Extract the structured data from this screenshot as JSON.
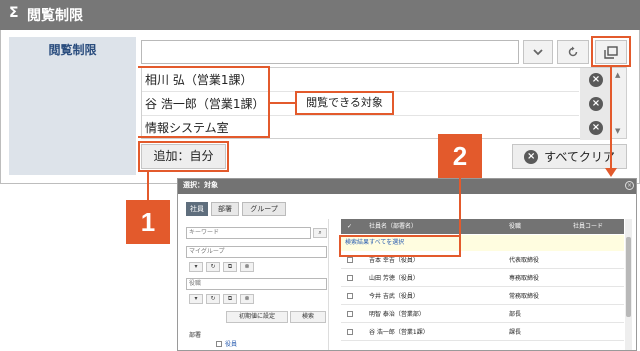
{
  "section": {
    "icon": "sigma-icon",
    "title": "閲覧制限"
  },
  "field": {
    "label": "閲覧制限",
    "selected": [
      "相川 弘（営業1課）",
      "谷 浩一郎（営業1課）",
      "情報システム室"
    ],
    "add_button": "追加：自分",
    "clear_button": "すべてクリア"
  },
  "callouts": {
    "list_label": "閲覧できる対象",
    "number_1": "1",
    "number_2": "2"
  },
  "dialog": {
    "title": "選択：対象",
    "tabs": [
      "社員",
      "部署",
      "グループ"
    ],
    "keyword_placeholder": "キーワード",
    "group_placeholder": "マイグループ",
    "position_placeholder": "役職",
    "reset_button": "初期値に設定",
    "search_button": "検索",
    "dept_label": "部署",
    "dept_item": "役員",
    "columns": {
      "check": "✓",
      "name": "社員名（部署名）",
      "position": "役職",
      "code": "社員コード"
    },
    "select_all": "検索結果すべてを選択",
    "rows": [
      {
        "name": "吉本 幸吉（役員）",
        "position": "代表取締役"
      },
      {
        "name": "山田 芳徳（役員）",
        "position": "専務取締役"
      },
      {
        "name": "今井 吉武（役員）",
        "position": "常務取締役"
      },
      {
        "name": "明智 泰治（営業部）",
        "position": "部長"
      },
      {
        "name": "谷 浩一郎（営業1課）",
        "position": "課長"
      }
    ]
  },
  "colors": {
    "accent": "#e35a2c",
    "header": "#777777",
    "label_bg": "#dde3ea",
    "label_text": "#2a4d7e"
  }
}
